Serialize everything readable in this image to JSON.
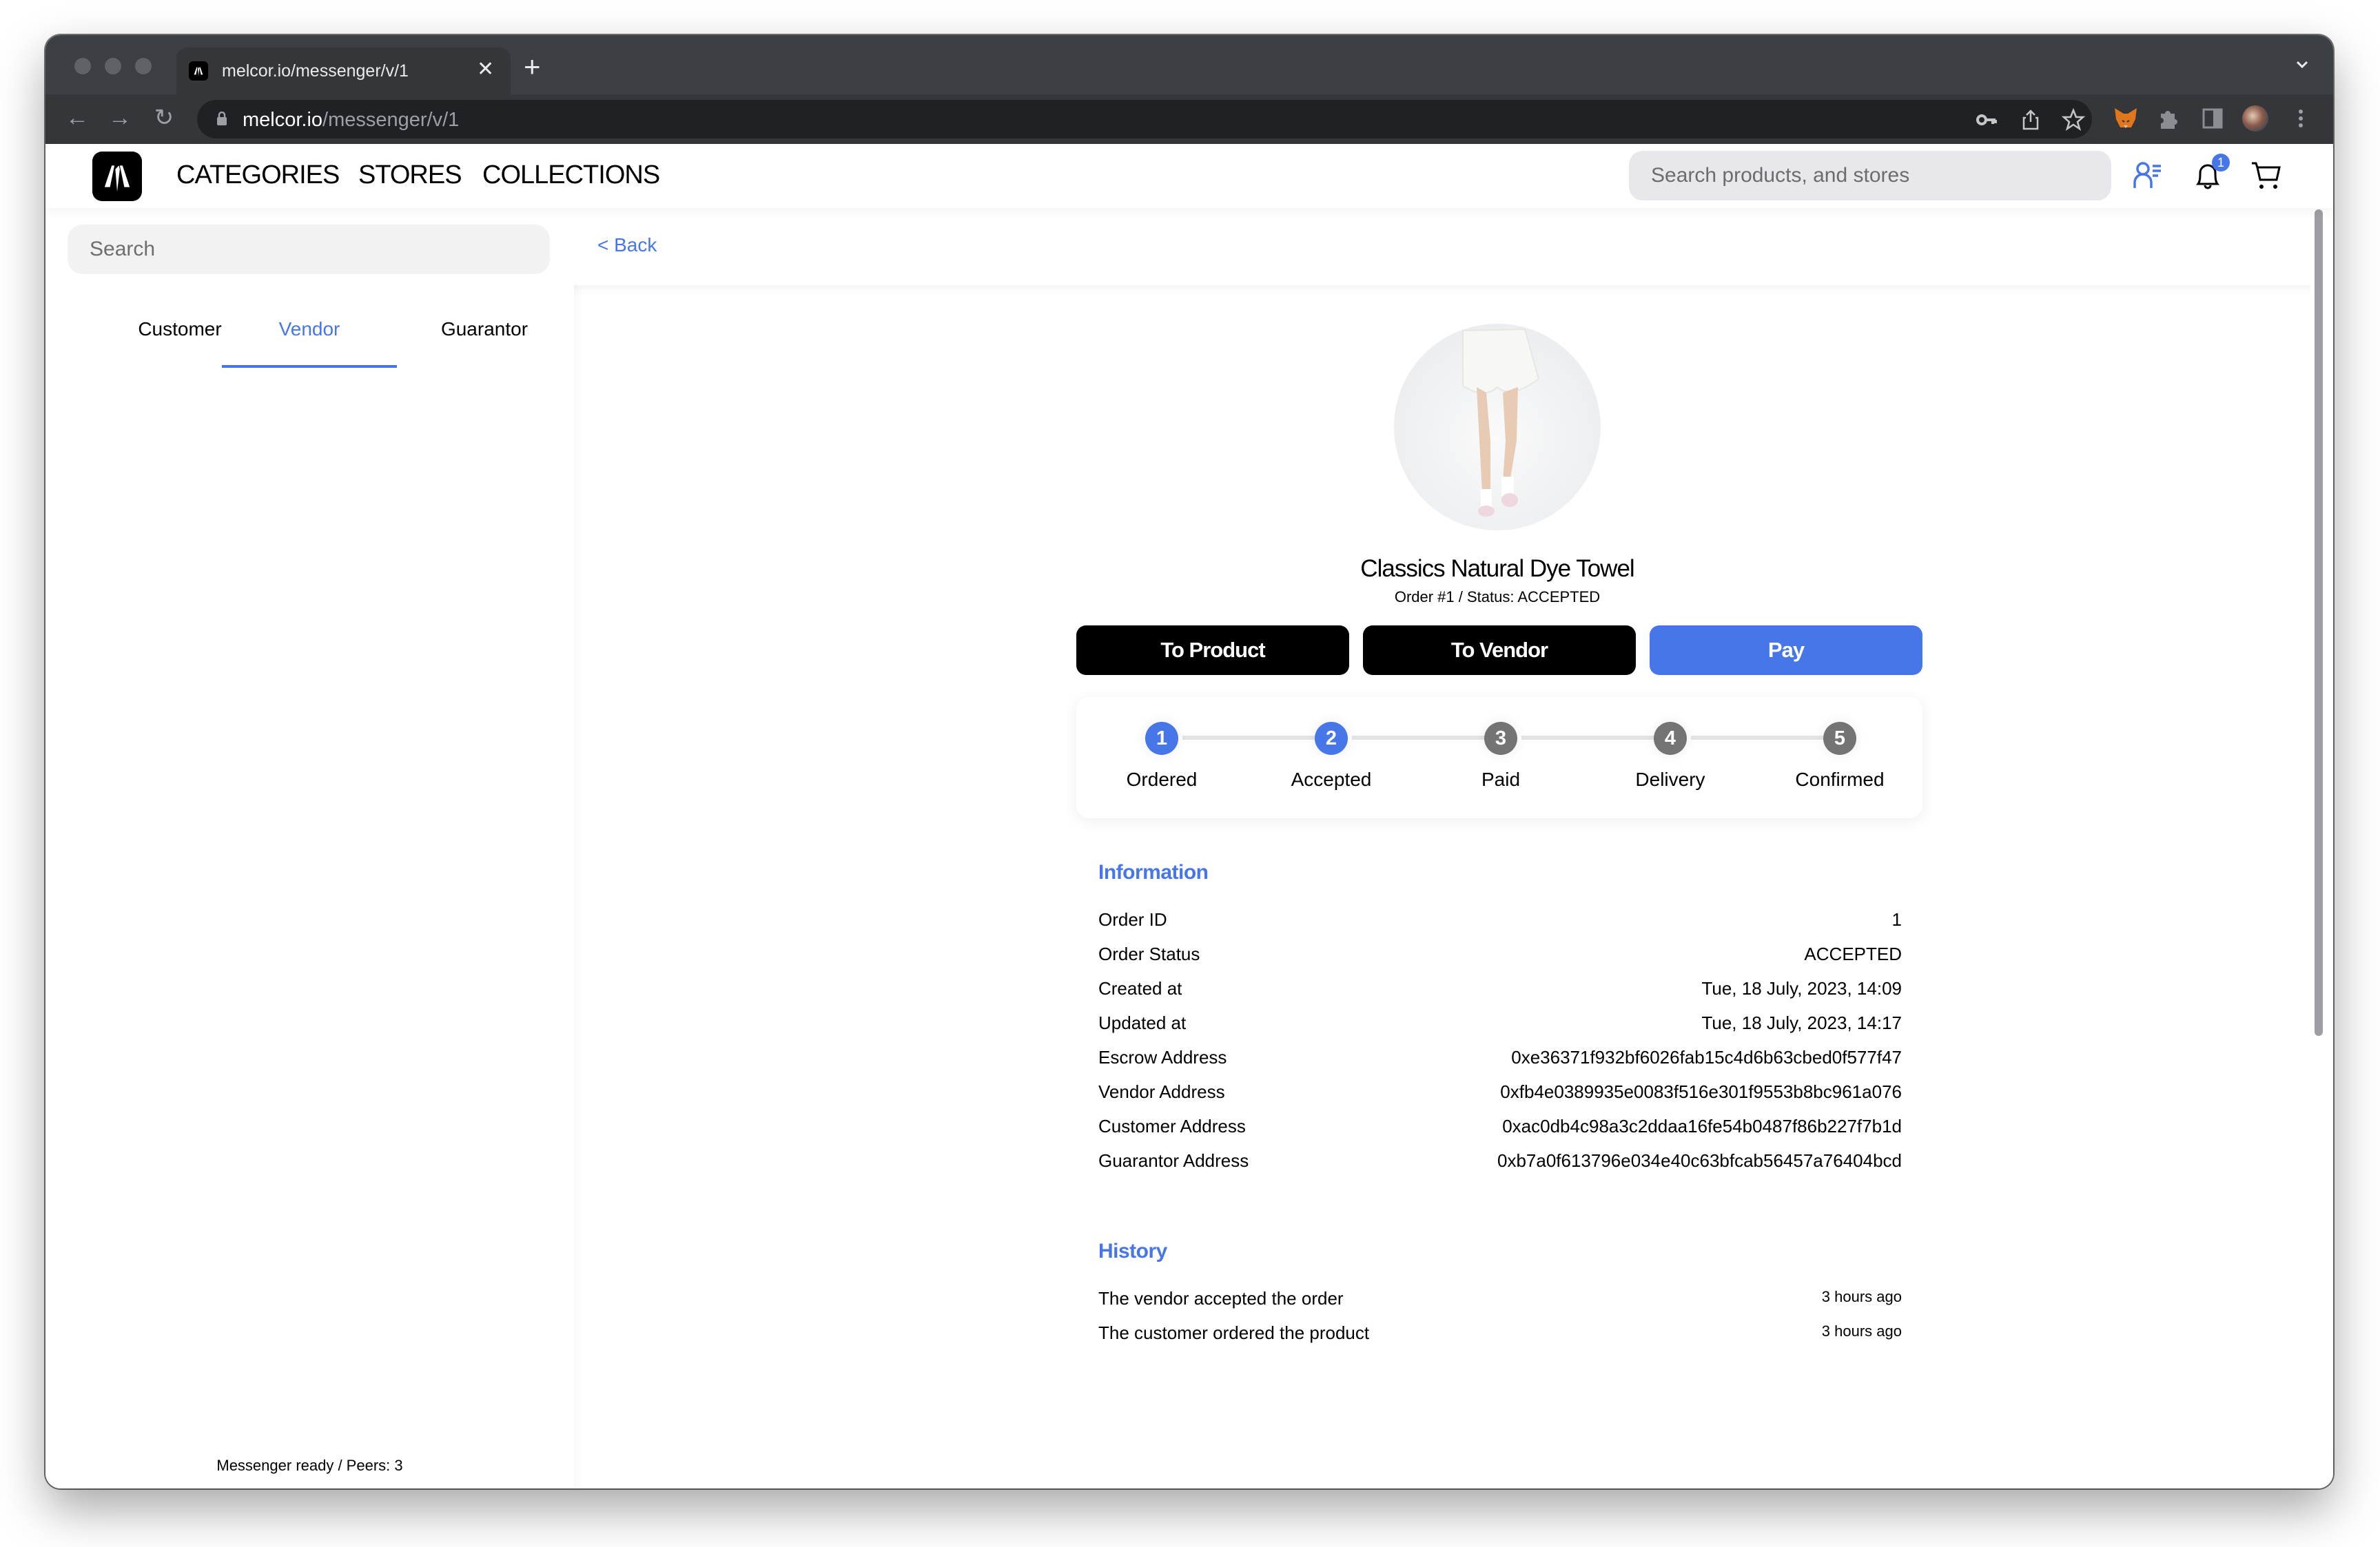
{
  "browser": {
    "tab_title": "melcor.io/messenger/v/1",
    "url_host": "melcor.io",
    "url_path": "/messenger/v/1",
    "toolbar_icons": [
      "key-icon",
      "share-icon",
      "star-icon",
      "metamask-extension-icon",
      "extensions-puzzle-icon",
      "side-panel-icon",
      "profile-avatar",
      "more-menu-icon"
    ]
  },
  "header": {
    "nav": [
      "CATEGORIES",
      "STORES",
      "COLLECTIONS"
    ],
    "search_placeholder": "Search products, and stores",
    "notification_count": "1",
    "icons": [
      "user-list-icon",
      "bell-icon",
      "cart-icon"
    ]
  },
  "sidebar": {
    "search_placeholder": "Search",
    "tabs": [
      {
        "label": "Customer",
        "active": false
      },
      {
        "label": "Vendor",
        "active": true
      },
      {
        "label": "Guarantor",
        "active": false
      }
    ],
    "status": "Messenger ready / Peers: 3"
  },
  "main": {
    "back_label": "< Back",
    "product": {
      "title": "Classics Natural Dye Towel",
      "subtitle": "Order #1 / Status: ACCEPTED"
    },
    "buttons": {
      "to_product": "To Product",
      "to_vendor": "To Vendor",
      "pay": "Pay"
    },
    "steps": [
      {
        "number": "1",
        "label": "Ordered",
        "done": true
      },
      {
        "number": "2",
        "label": "Accepted",
        "done": true
      },
      {
        "number": "3",
        "label": "Paid",
        "done": false
      },
      {
        "number": "4",
        "label": "Delivery",
        "done": false
      },
      {
        "number": "5",
        "label": "Confirmed",
        "done": false
      }
    ],
    "information": {
      "title": "Information",
      "rows": [
        {
          "key": "Order ID",
          "value": "1"
        },
        {
          "key": "Order Status",
          "value": "ACCEPTED"
        },
        {
          "key": "Created at",
          "value": "Tue, 18 July, 2023, 14:09"
        },
        {
          "key": "Updated at",
          "value": "Tue, 18 July, 2023, 14:17"
        },
        {
          "key": "Escrow Address",
          "value": "0xe36371f932bf6026fab15c4d6b63cbed0f577f47"
        },
        {
          "key": "Vendor Address",
          "value": "0xfb4e0389935e0083f516e301f9553b8bc961a076"
        },
        {
          "key": "Customer Address",
          "value": "0xac0db4c98a3c2ddaa16fe54b0487f86b227f7b1d"
        },
        {
          "key": "Guarantor Address",
          "value": "0xb7a0f613796e034e40c63bfcab56457a76404bcd"
        }
      ]
    },
    "history": {
      "title": "History",
      "rows": [
        {
          "event": "The vendor accepted the order",
          "time": "3 hours ago"
        },
        {
          "event": "The customer ordered the product",
          "time": "3 hours ago"
        }
      ]
    }
  },
  "colors": {
    "accent": "#4676e8",
    "step_pending": "#747474",
    "button_dark": "#000000"
  }
}
